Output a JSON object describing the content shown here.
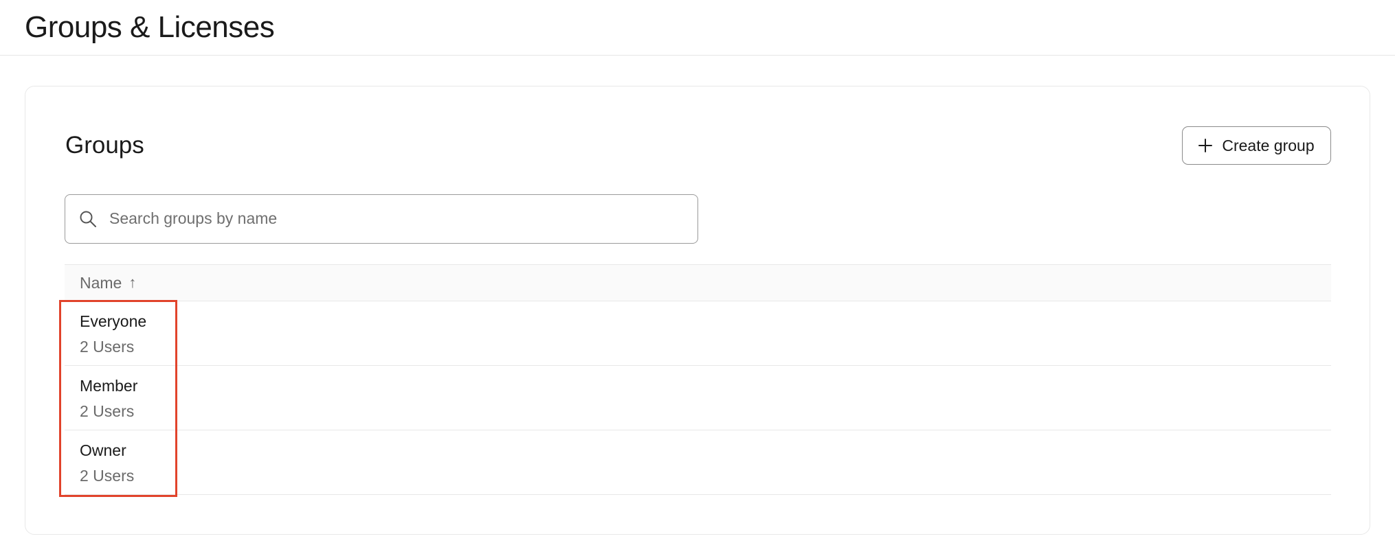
{
  "page": {
    "title": "Groups & Licenses"
  },
  "groups_card": {
    "title": "Groups",
    "create_button_label": "Create group",
    "search": {
      "placeholder": "Search groups by name",
      "value": ""
    },
    "table": {
      "columns": [
        {
          "label": "Name",
          "sort": "ascending",
          "sort_icon": "arrow-up-icon"
        }
      ],
      "rows": [
        {
          "name": "Everyone",
          "count": "2 Users"
        },
        {
          "name": "Member",
          "count": "2 Users"
        },
        {
          "name": "Owner",
          "count": "2 Users"
        }
      ]
    }
  },
  "highlight": {
    "color": "#e1432b",
    "target": "group name column"
  },
  "icons": {
    "create": "plus-icon",
    "search": "search-icon",
    "sort": "arrow-up-icon"
  }
}
